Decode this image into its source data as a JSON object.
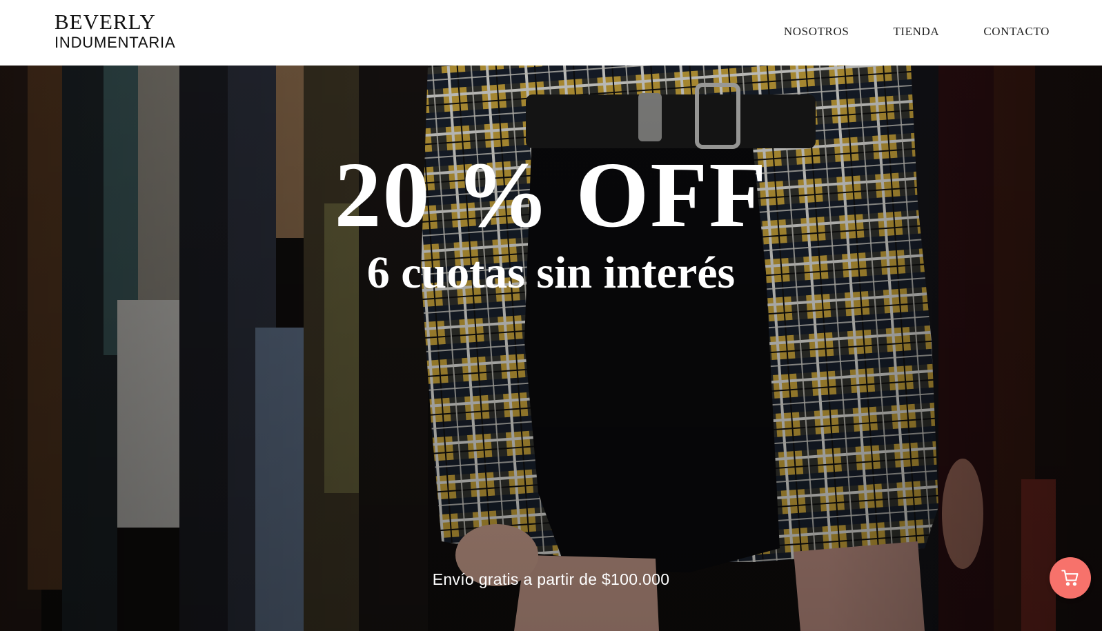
{
  "brand": {
    "line1": "BEVERLY",
    "line2": "INDUMENTARIA"
  },
  "nav": {
    "items": [
      {
        "label": "NOSOTROS"
      },
      {
        "label": "TIENDA"
      },
      {
        "label": "CONTACTO"
      }
    ]
  },
  "hero": {
    "title": "20 % OFF",
    "subtitle": "6 cuotas sin interés",
    "shipping_note": "Envío gratis a partir de $100.000",
    "image_description_icon": "plaid-shirt-photo"
  },
  "cart": {
    "icon": "shopping-cart-icon",
    "color": "#f7726b"
  },
  "colors": {
    "header_bg": "#ffffff",
    "text_dark": "#111111",
    "hero_text": "#ffffff"
  }
}
